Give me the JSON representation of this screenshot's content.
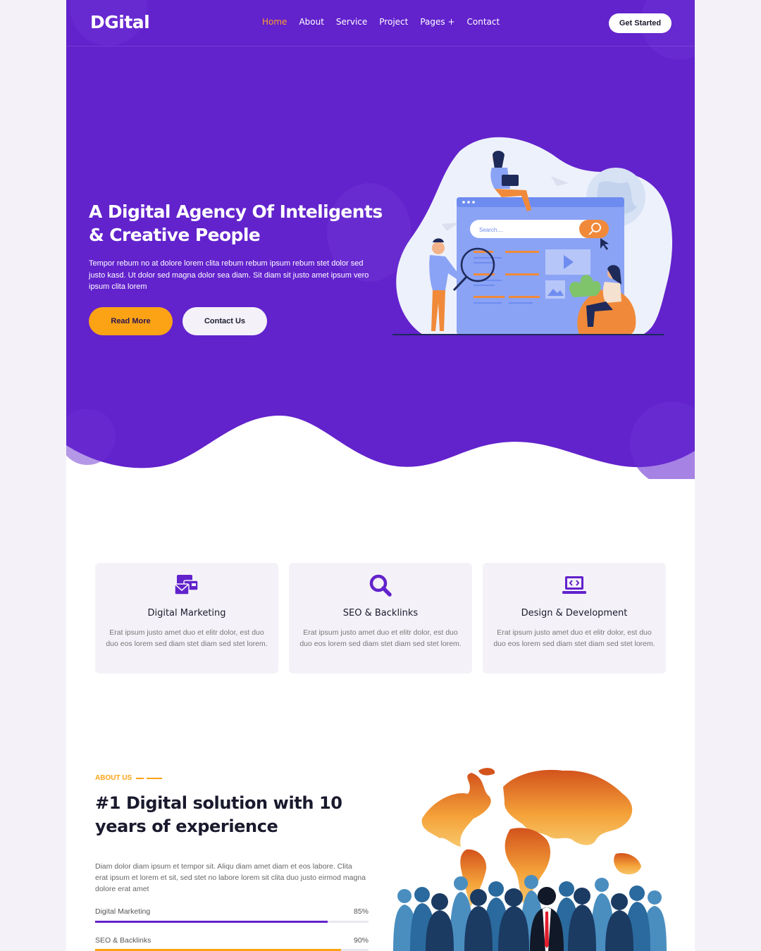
{
  "brand": {
    "logo": "DGital"
  },
  "nav": {
    "items": [
      {
        "label": "Home",
        "active": true
      },
      {
        "label": "About",
        "active": false
      },
      {
        "label": "Service",
        "active": false
      },
      {
        "label": "Project",
        "active": false
      },
      {
        "label": "Pages +",
        "active": false
      },
      {
        "label": "Contact",
        "active": false
      }
    ],
    "cta_label": "Get Started"
  },
  "hero": {
    "title": "A Digital Agency Of Inteligents & Creative People",
    "text": "Tempor rebum no at dolore lorem clita rebum rebum ipsum rebum stet dolor sed justo kasd. Ut dolor sed magna dolor sea diam. Sit diam sit justo amet ipsum vero ipsum clita lorem",
    "read_more_label": "Read More",
    "contact_label": "Contact Us",
    "illustration": {
      "search_placeholder": "Search...."
    }
  },
  "services": [
    {
      "icon": "mail-stack-icon",
      "title": "Digital Marketing",
      "text": "Erat ipsum justo amet duo et elitr dolor, est duo duo eos lorem sed diam stet diam sed stet lorem."
    },
    {
      "icon": "search-icon",
      "title": "SEO & Backlinks",
      "text": "Erat ipsum justo amet duo et elitr dolor, est duo duo eos lorem sed diam stet diam sed stet lorem."
    },
    {
      "icon": "laptop-code-icon",
      "title": "Design & Development",
      "text": "Erat ipsum justo amet duo et elitr dolor, est duo duo eos lorem sed diam stet diam sed stet lorem."
    }
  ],
  "about": {
    "tag": "ABOUT US",
    "title": "#1 Digital solution with 10 years of experience",
    "text": "Diam dolor diam ipsum et tempor sit. Aliqu diam amet diam et eos labore. Clita erat ipsum et lorem et sit, sed stet no labore lorem sit clita duo justo eirmod magna dolore erat amet",
    "skills": [
      {
        "label": "Digital Marketing",
        "value": "85%",
        "percent": 85,
        "color": "#6222cc"
      },
      {
        "label": "SEO & Backlinks",
        "value": "90%",
        "percent": 90,
        "color": "#fca315"
      }
    ]
  },
  "colors": {
    "primary": "#6222cc",
    "accent": "#fca315",
    "light_bg": "#f4f2f8"
  }
}
